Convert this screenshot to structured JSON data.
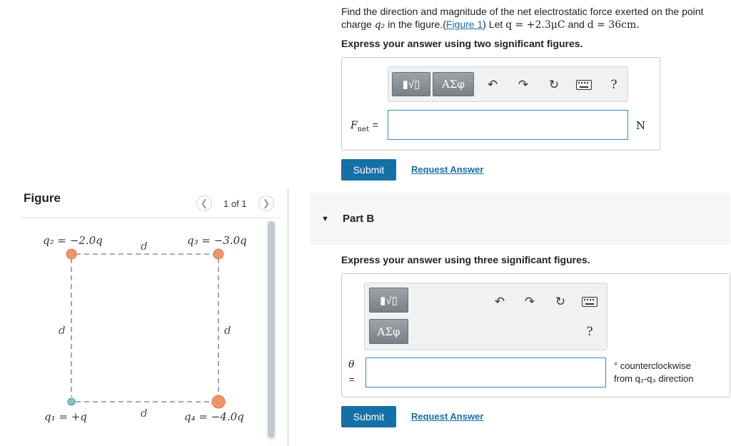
{
  "figure": {
    "title": "Figure",
    "pager": "1 of 1",
    "labels": {
      "q1": "q₁ = +q",
      "q2": "q₂ = −2.0q",
      "q3": "q₃ = −3.0q",
      "q4": "q₄ = −4.0q",
      "d_top": "d",
      "d_left": "d",
      "d_right": "d",
      "d_bottom": "d"
    },
    "colors": {
      "charge_negative": "#f0956a",
      "charge_positive": "#7fc4c0",
      "lines": "#777777"
    }
  },
  "part_a": {
    "problem_prefix": "Find the direction and magnitude of the net electrostatic force exerted on the point charge",
    "problem_charge": "q₂",
    "problem_mid": "in the figure.(",
    "figure_link": "Figure 1",
    "problem_given_prefix": ") Let",
    "given_q": "q = +2.3μC",
    "and": "and",
    "given_d": "d = 36cm.",
    "instruction": "Express your answer using two significant figures.",
    "toolbar": {
      "template": "▮√▯",
      "greek": "ΑΣφ",
      "help": "?"
    },
    "input_label": "F",
    "input_subscript": "net",
    "input_eq": "=",
    "input_value": "",
    "unit": "N",
    "submit": "Submit",
    "request": "Request Answer"
  },
  "part_b": {
    "title": "Part B",
    "instruction": "Express your answer using three significant figures.",
    "toolbar": {
      "template": "▮√▯",
      "greek": "ΑΣφ",
      "help": "?"
    },
    "input_label": "θ",
    "input_eq": "=",
    "input_value": "",
    "unit_line1": "° counterclockwise",
    "unit_line2": "from q₂-q₃ direction",
    "submit": "Submit",
    "request": "Request Answer"
  },
  "colors": {
    "accent": "#1570a6",
    "input_border": "#2d8fc0"
  }
}
